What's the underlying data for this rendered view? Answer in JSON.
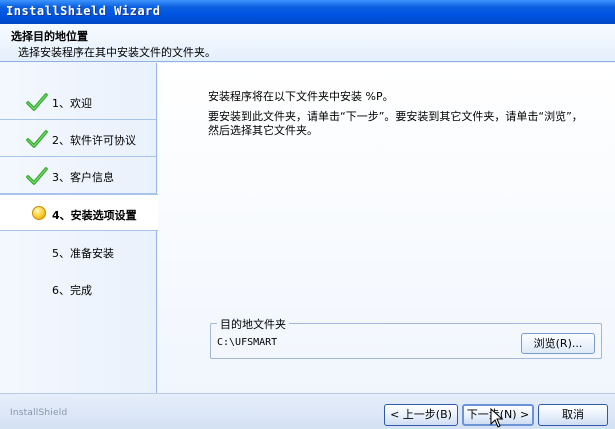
{
  "window": {
    "title": "InstallShield Wizard"
  },
  "header": {
    "title": "选择目的地位置",
    "subtitle": "选择安装程序在其中安装文件的文件夹。"
  },
  "steps": [
    {
      "label": "1、欢迎",
      "state": "done"
    },
    {
      "label": "2、软件许可协议",
      "state": "done"
    },
    {
      "label": "3、客户信息",
      "state": "done"
    },
    {
      "label": "4、安装选项设置",
      "state": "current"
    },
    {
      "label": "5、准备安装",
      "state": "pending"
    },
    {
      "label": "6、完成",
      "state": "pending"
    }
  ],
  "content": {
    "line1": "安装程序将在以下文件夹中安装 %P。",
    "line2": "要安装到此文件夹，请单击“下一步”。要安装到其它文件夹，请单击“浏览”，",
    "line3": "然后选择其它文件夹。"
  },
  "destination": {
    "legend": "目的地文件夹",
    "path": "C:\\UFSMART",
    "browse_label": "浏览(R)..."
  },
  "footer": {
    "brand": "InstallShield",
    "back_label": "< 上一步(B)",
    "next_label": "下一步(N) >",
    "cancel_label": "取消"
  },
  "colors": {
    "titlebar": "#0054e3",
    "check": "#2fa82f",
    "bulb": "#ffd640",
    "button_border": "#2f5aa8"
  }
}
